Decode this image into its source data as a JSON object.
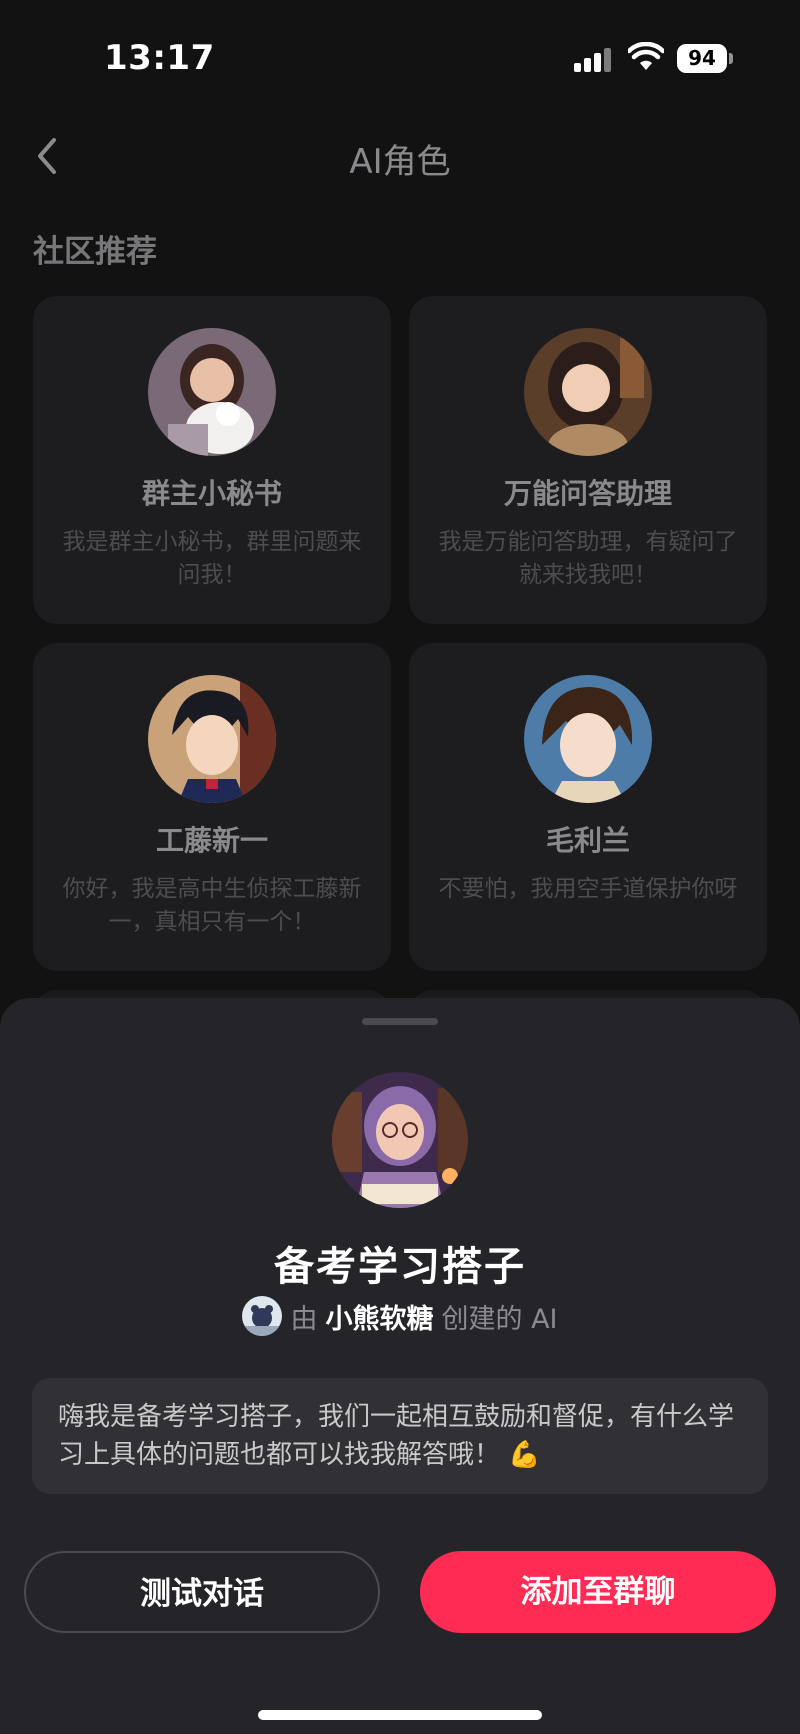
{
  "status_bar": {
    "time": "13:17",
    "battery": "94"
  },
  "nav": {
    "title": "AI角色",
    "back_icon": "chevron-left-icon"
  },
  "section": {
    "title": "社区推荐"
  },
  "cards": [
    {
      "name": "群主小秘书",
      "desc": "我是群主小秘书，群里问题来问我！"
    },
    {
      "name": "万能问答助理",
      "desc": "我是万能问答助理，有疑问了就来找我吧！"
    },
    {
      "name": "工藤新一",
      "desc": "你好，我是高中生侦探工藤新一，真相只有一个！"
    },
    {
      "name": "毛利兰",
      "desc": "不要怕，我用空手道保护你呀"
    }
  ],
  "sheet": {
    "name": "备考学习搭子",
    "by": "由",
    "creator": "小熊软糖",
    "created_suffix": "创建的 AI",
    "greeting": "嗨我是备考学习搭子，我们一起相互鼓励和督促，有什么学习上具体的问题也都可以找我解答哦！ 💪",
    "test_button": "测试对话",
    "add_button": "添加至群聊"
  },
  "colors": {
    "accent": "#fe2c55",
    "sheet_bg": "#252529",
    "page_bg": "#121213"
  }
}
